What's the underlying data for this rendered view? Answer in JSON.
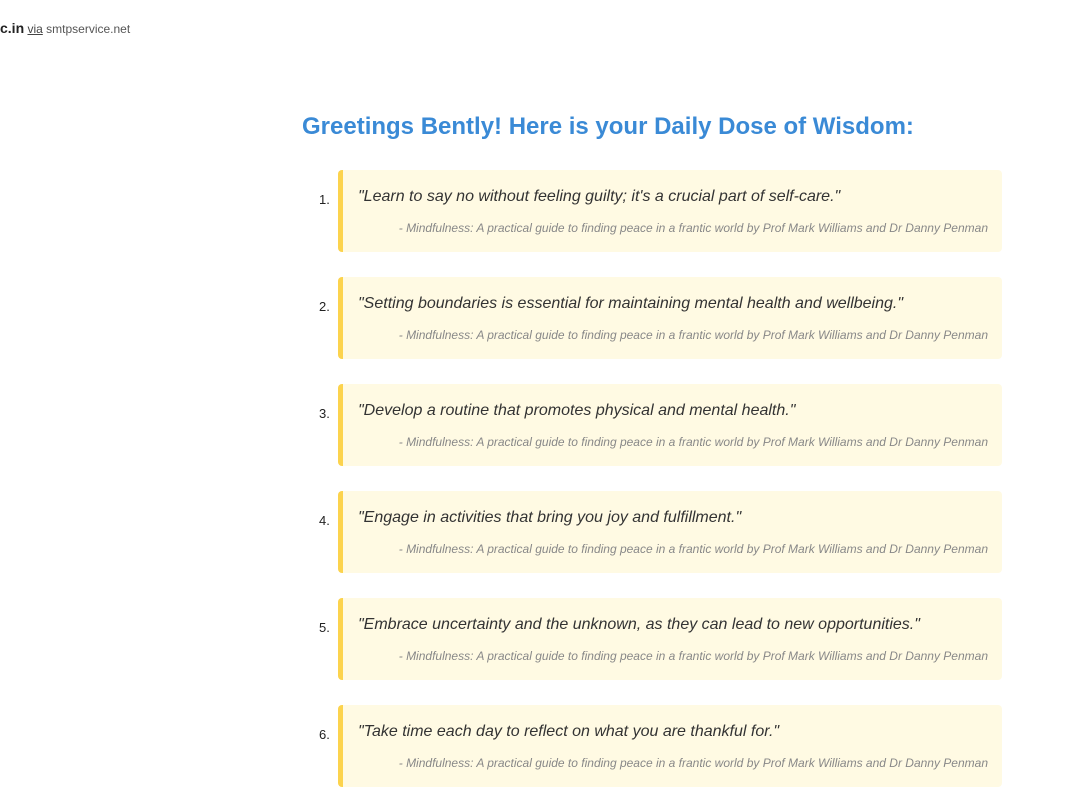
{
  "header": {
    "sender_domain": "c.in",
    "via_label": "via",
    "service": "smtpservice.net"
  },
  "greeting": "Greetings Bently! Here is your Daily Dose of Wisdom:",
  "quotes": [
    {
      "number": "1.",
      "text": "\"Learn to say no without feeling guilty; it's a crucial part of self-care.\"",
      "source": "- Mindfulness: A practical guide to finding peace in a frantic world by Prof Mark Williams and Dr Danny Penman"
    },
    {
      "number": "2.",
      "text": "\"Setting boundaries is essential for maintaining mental health and wellbeing.\"",
      "source": "- Mindfulness: A practical guide to finding peace in a frantic world by Prof Mark Williams and Dr Danny Penman"
    },
    {
      "number": "3.",
      "text": "\"Develop a routine that promotes physical and mental health.\"",
      "source": "- Mindfulness: A practical guide to finding peace in a frantic world by Prof Mark Williams and Dr Danny Penman"
    },
    {
      "number": "4.",
      "text": "\"Engage in activities that bring you joy and fulfillment.\"",
      "source": "- Mindfulness: A practical guide to finding peace in a frantic world by Prof Mark Williams and Dr Danny Penman"
    },
    {
      "number": "5.",
      "text": "\"Embrace uncertainty and the unknown, as they can lead to new opportunities.\"",
      "source": "- Mindfulness: A practical guide to finding peace in a frantic world by Prof Mark Williams and Dr Danny Penman"
    },
    {
      "number": "6.",
      "text": "\"Take time each day to reflect on what you are thankful for.\"",
      "source": "- Mindfulness: A practical guide to finding peace in a frantic world by Prof Mark Williams and Dr Danny Penman"
    }
  ],
  "colors": {
    "greeting": "#3a8ad6",
    "quote_background": "#fffae3",
    "quote_accent": "#fcd34d"
  }
}
